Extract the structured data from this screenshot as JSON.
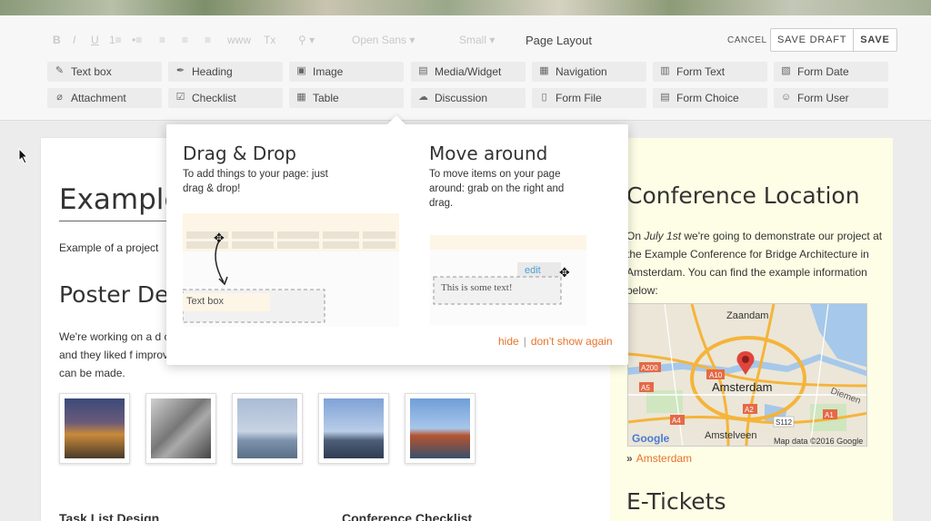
{
  "toolbar": {
    "format_buttons": [
      "B",
      "I",
      "U",
      "1≡",
      "•≡",
      "≡",
      "≡",
      "≡",
      "www",
      "Tx",
      "⚲ ▾",
      "Open Sans ▾",
      "Small ▾"
    ],
    "page_layout_label": "Page Layout",
    "cancel_label": "CANCEL",
    "save_draft_label": "SAVE DRAFT",
    "save_label": "SAVE",
    "widgets_row1": [
      {
        "label": "Text box",
        "icon": "edit-icon"
      },
      {
        "label": "Heading",
        "icon": "heading-icon"
      },
      {
        "label": "Image",
        "icon": "image-icon"
      },
      {
        "label": "Media/Widget",
        "icon": "media-icon"
      },
      {
        "label": "Navigation",
        "icon": "navigation-icon"
      },
      {
        "label": "Form Text",
        "icon": "form-text-icon"
      },
      {
        "label": "Form Date",
        "icon": "calendar-icon"
      }
    ],
    "widgets_row2": [
      {
        "label": "Attachment",
        "icon": "paperclip-icon"
      },
      {
        "label": "Checklist",
        "icon": "checklist-icon"
      },
      {
        "label": "Table",
        "icon": "table-icon"
      },
      {
        "label": "Discussion",
        "icon": "discussion-icon"
      },
      {
        "label": "Form File",
        "icon": "form-file-icon"
      },
      {
        "label": "Form Choice",
        "icon": "form-choice-icon"
      },
      {
        "label": "Form User",
        "icon": "form-user-icon"
      }
    ]
  },
  "popup": {
    "drag_title": "Drag & Drop",
    "drag_text": "To add things to your page: just drag & drop!",
    "drag_illustration_item": "Text box",
    "move_title": "Move around",
    "move_text": "To move items on your page around: grab on the right and drag.",
    "move_illustration_edit": "edit",
    "move_illustration_text": "This is some text!",
    "hide_label": "hide",
    "separator": "|",
    "dont_show_label": "don't show again"
  },
  "page": {
    "title": "Example",
    "intro": "Example of a project",
    "poster_heading": "Poster De",
    "poster_text": "We're working on a d client, and they liked f improvements can be made.",
    "task_heading": "Task List Design",
    "conference_checklist_heading": "Conference Checklist"
  },
  "aside": {
    "conf_title": "Conference Location",
    "conf_text_pre": "On ",
    "conf_text_date": "July 1st",
    "conf_text_post": " we're going to demonstrate our project at the Example Conference for Bridge Architecture in Amsterdam. You can find the example information below:",
    "map_labels": {
      "zaandam": "Zaandam",
      "amsterdam": "Amsterdam",
      "amstelveen": "Amstelveen",
      "diemen": "Diemen",
      "google": "Google",
      "map_data": "Map data ©2016 Google",
      "a10": "A10",
      "a200": "A200",
      "a5": "A5",
      "a2": "A2",
      "a1": "A1",
      "s112": "S112",
      "a4": "A4"
    },
    "map_link_arrow": "»",
    "map_link": "Amsterdam",
    "etickets_title": "E-Tickets"
  },
  "colors": {
    "accent": "#e8732a",
    "link_blue": "#4a9fd6",
    "aside_bg": "#fefee6"
  }
}
